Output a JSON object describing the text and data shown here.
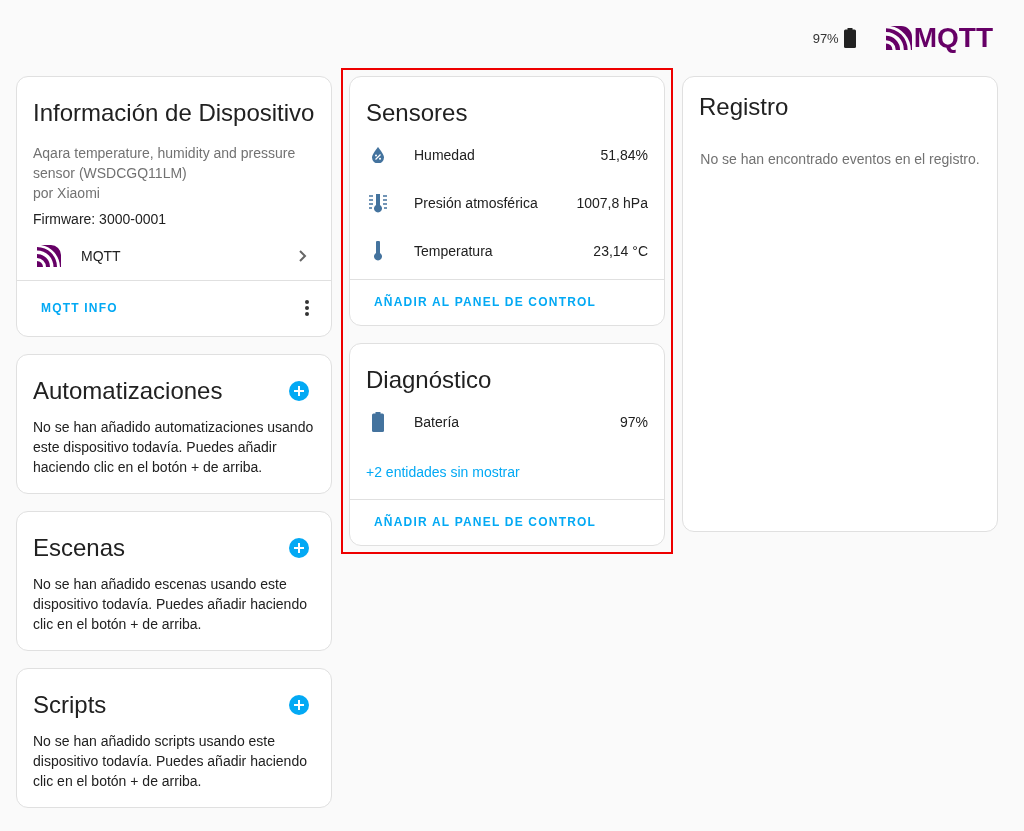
{
  "header": {
    "battery": "97%",
    "logo_text": "MQTT"
  },
  "device_info": {
    "title": "Información de Dispositivo",
    "model": "Aqara temperature, humidity and pressure sensor (WSDCGQ11LM)",
    "manufacturer": "por Xiaomi",
    "firmware": "Firmware: 3000-0001",
    "integration": "MQTT",
    "action": "MQTT INFO"
  },
  "related_cards": [
    {
      "title": "Automatizaciones",
      "message": "No se han añadido automatizaciones usando este dispositivo todavía. Puedes añadir haciendo clic en el botón + de arriba."
    },
    {
      "title": "Escenas",
      "message": "No se han añadido escenas usando este dispositivo todavía. Puedes añadir haciendo clic en el botón + de arriba."
    },
    {
      "title": "Scripts",
      "message": "No se han añadido scripts usando este dispositivo todavía. Puedes añadir haciendo clic en el botón + de arriba."
    }
  ],
  "entity_cards_highlighted": true,
  "entity_cards": [
    {
      "title": "Sensores",
      "entities": [
        {
          "kind": "humidity",
          "name": "Humedad",
          "value": "51,84%"
        },
        {
          "kind": "pressure",
          "name": "Presión atmosférica",
          "value": "1007,8 hPa"
        },
        {
          "kind": "temperature",
          "name": "Temperatura",
          "value": "23,14 °C"
        }
      ],
      "action": "AÑADIR AL PANEL DE CONTROL"
    },
    {
      "title": "Diagnóstico",
      "entities": [
        {
          "kind": "battery",
          "name": "Batería",
          "value": "97%"
        }
      ],
      "more": "+2 entidades sin mostrar",
      "action": "AÑADIR AL PANEL DE CONTROL"
    }
  ],
  "log": {
    "title": "Registro",
    "message": "No se han encontrado eventos en el registro."
  }
}
